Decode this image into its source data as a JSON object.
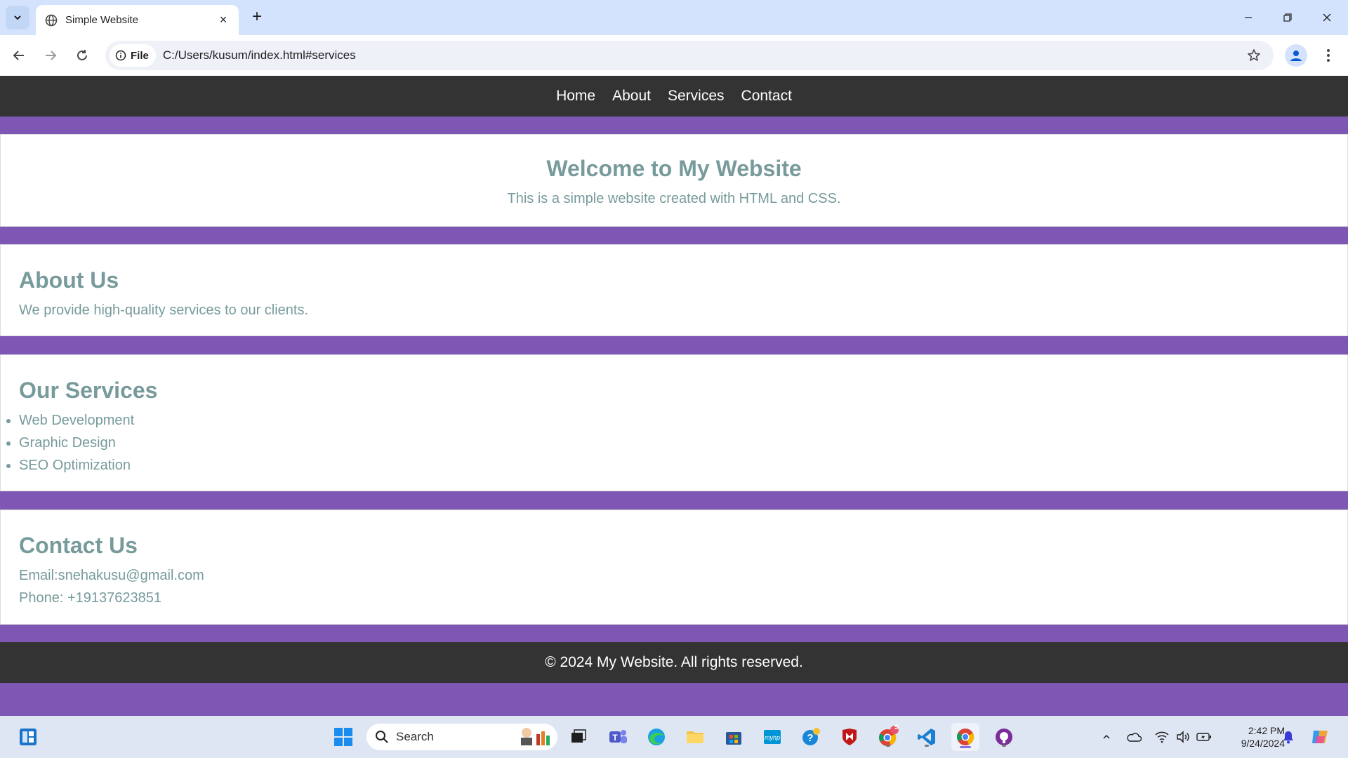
{
  "browser": {
    "tab_title": "Simple Website",
    "new_tab_label": "+",
    "close_tab_label": "×",
    "site_info_label": "File",
    "url": "C:/Users/kusum/index.html#services"
  },
  "site": {
    "nav": [
      "Home",
      "About",
      "Services",
      "Contact"
    ],
    "hero": {
      "title": "Welcome to My Website",
      "subtitle": "This is a simple website created with HTML and CSS."
    },
    "about": {
      "title": "About Us",
      "text": "We provide high-quality services to our clients."
    },
    "services": {
      "title": "Our Services",
      "items": [
        "Web Development",
        "Graphic Design",
        "SEO Optimization"
      ]
    },
    "contact": {
      "title": "Contact Us",
      "email": "Email:snehakusu@gmail.com",
      "phone": "Phone: +19137623851"
    },
    "footer": "© 2024 My Website. All rights reserved."
  },
  "taskbar": {
    "search_placeholder": "Search",
    "time": "2:42 PM",
    "date": "9/24/2024",
    "chrome_badge": "S"
  },
  "colors": {
    "page_bg": "#7e57b5",
    "nav_bg": "#333333",
    "text": "#779a9b"
  }
}
